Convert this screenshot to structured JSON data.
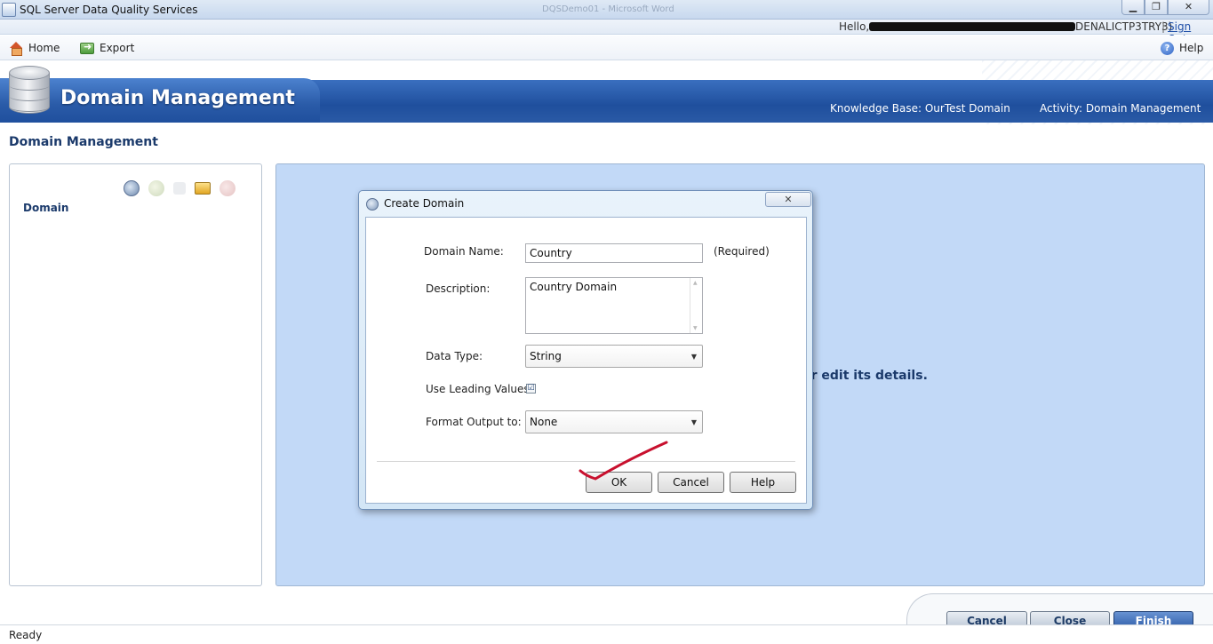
{
  "window": {
    "title": "SQL Server Data Quality Services",
    "ghost_title": "DQSDemo01 - Microsoft Word",
    "minimize_glyph": "▁",
    "maximize_glyph": "❐",
    "close_glyph": "✕"
  },
  "userbar": {
    "hello": "Hello,",
    "user_suffix": "DENALICTP3TRY3)",
    "separator": "|",
    "sign_out": "Sign Out"
  },
  "toolbar": {
    "home": "Home",
    "export": "Export",
    "help": "Help",
    "help_glyph": "?"
  },
  "banner": {
    "heading": "Domain Management",
    "knowledge_base": "Knowledge Base: OurTest Domain",
    "activity": "Activity: Domain Management"
  },
  "page": {
    "section_title": "Domain Management",
    "left_panel_label": "Domain",
    "right_panel_hint": "or edit its details."
  },
  "dialog": {
    "title": "Create Domain",
    "close_glyph": "✕",
    "domain_name_label": "Domain Name:",
    "domain_name_value": "Country",
    "required_note": "(Required)",
    "description_label": "Description:",
    "description_value": "Country Domain",
    "data_type_label": "Data Type:",
    "data_type_value": "String",
    "use_leading_label": "Use Leading Values",
    "use_leading_checked": "☑",
    "format_output_label": "Format Output to:",
    "format_output_value": "None",
    "ok": "OK",
    "cancel": "Cancel",
    "help": "Help",
    "dropdown_glyph": "▼",
    "scroll_up_glyph": "▲",
    "scroll_down_glyph": "▼"
  },
  "footer": {
    "cancel": "Cancel",
    "close": "Close",
    "finish": "Finish"
  },
  "statusbar": {
    "status": "Ready"
  },
  "colors": {
    "banner_blue": "#1f4f9d",
    "panel_blue": "#c2d9f7",
    "annotation_red": "#c8102e",
    "finish_blue": "#2b5aa6"
  }
}
